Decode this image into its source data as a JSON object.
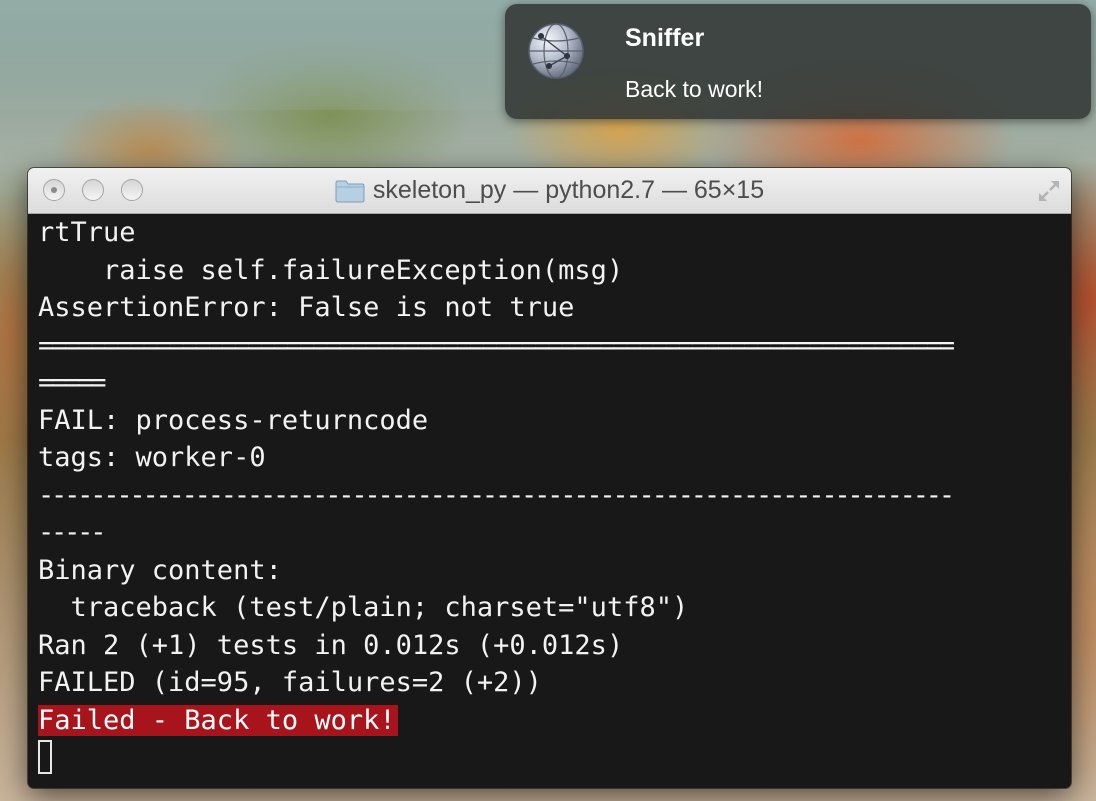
{
  "notification": {
    "app_name": "Sniffer",
    "message": "Back to work!",
    "icon": "network-globe-icon"
  },
  "window": {
    "title": "skeleton_py — python2.7 — 65×15",
    "controls": [
      "close-button",
      "minimize-button",
      "zoom-button"
    ],
    "folder_icon": "folder-icon",
    "fullscreen_icon": "fullscreen-icon"
  },
  "terminal": {
    "lines": [
      "rtTrue",
      "    raise self.failureException(msg)",
      "AssertionError: False is not true",
      "======================================================================",
      "=====",
      "FAIL: process-returncode",
      "tags: worker-0",
      "----------------------------------------------------------------------",
      "-----",
      "Binary content:",
      "  traceback (test/plain; charset=\"utf8\")",
      "Ran 2 (+1) tests in 0.012s (+0.012s)",
      "FAILED (id=95, failures=2 (+2))"
    ],
    "status_line": "Failed - Back to work!",
    "status_color": "#a8141c"
  }
}
